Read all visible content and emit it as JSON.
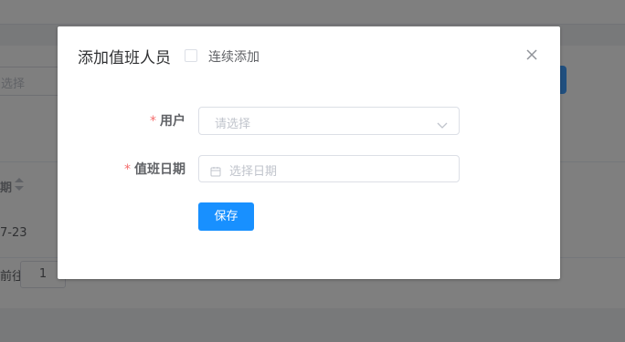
{
  "background": {
    "select_placeholder": "选择",
    "table_header": "期",
    "row_date": "7-23",
    "pager_goto": "前往",
    "pager_page": "1"
  },
  "dialog": {
    "title": "添加值班人员",
    "continuous_add_label": "连续添加",
    "continuous_add_checked": false,
    "close_icon": "close-icon",
    "form": {
      "user_label": "用户",
      "user_placeholder": "请选择",
      "date_label": "值班日期",
      "date_placeholder": "选择日期",
      "required_mark": "*"
    },
    "save_label": "保存"
  },
  "colors": {
    "primary": "#1890ff",
    "required": "#f56c6c",
    "placeholder": "#c0c4cc",
    "overlay": "rgba(0,0,0,0.5)"
  }
}
